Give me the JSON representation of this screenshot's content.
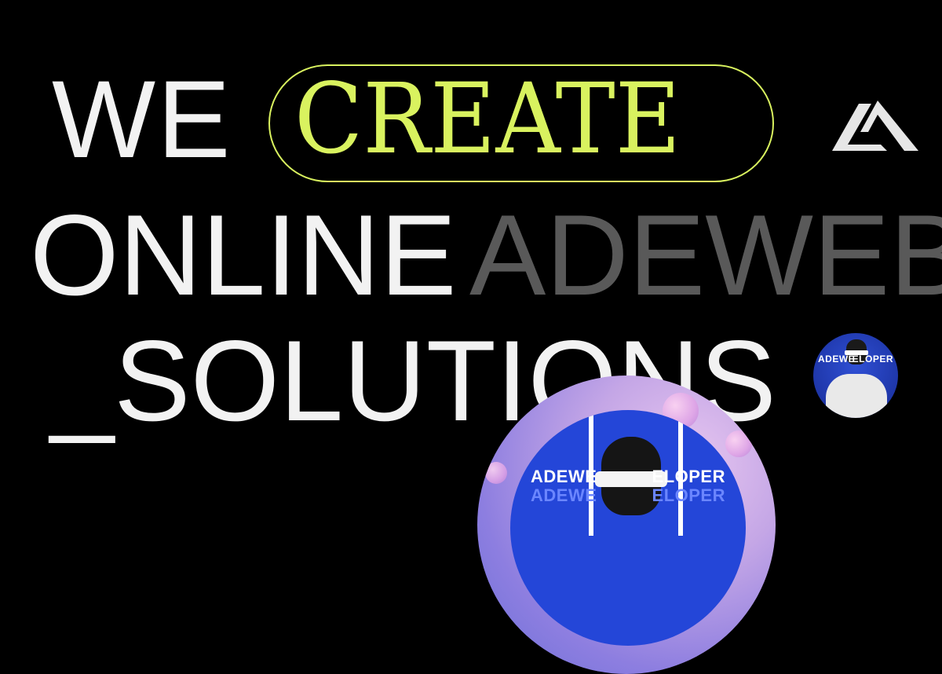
{
  "headline": {
    "word1": "WE",
    "word2": "CREATE",
    "word3": "ONLINE",
    "word4": "ADEWEB",
    "word5": "_SOLUTIONS"
  },
  "badge": {
    "line1_left": "ADEWE",
    "line1_right": "ELOPER",
    "line2_left": "ADEWE",
    "line2_right": "ELOPER",
    "small_left": "ADEWE",
    "small_right": "ELOPER"
  },
  "colors": {
    "background": "#000000",
    "accent": "#d9f25f",
    "primary_text": "#f2f2f2",
    "muted_text": "#595959",
    "badge_blue": "#2446d8"
  },
  "icons": {
    "brand_logo": "adeweb-logo"
  }
}
